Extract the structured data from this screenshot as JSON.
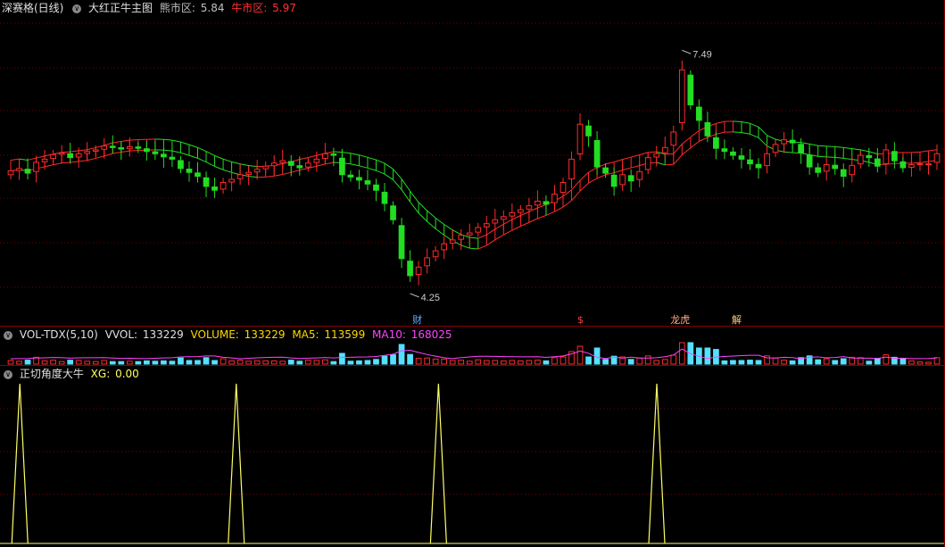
{
  "main": {
    "stock_name": "深赛格(日线)",
    "indicator_name": "大红正牛主图",
    "bear_label": "熊市区:",
    "bear_value": "5.84",
    "bull_label": "牛市区:",
    "bull_value": "5.97",
    "high_label": "7.49",
    "low_label": "4.25",
    "markers": [
      "财",
      "$",
      "龙虎",
      "解"
    ],
    "colors": {
      "up": "#ff2a2a",
      "down": "#22dd22",
      "band_up": "#ff2a2a",
      "band_down": "#22dd22"
    }
  },
  "volume": {
    "name": "VOL-TDX(5,10)",
    "vvol_label": "VVOL:",
    "vvol_value": "133229",
    "volume_label": "VOLUME:",
    "volume_value": "133229",
    "ma5_label": "MA5:",
    "ma5_value": "113599",
    "ma10_label": "MA10:",
    "ma10_value": "168025"
  },
  "indicator": {
    "name": "正切角度大牛",
    "xg_label": "XG:",
    "xg_value": "0.00",
    "peak_positions": [
      0.021,
      0.25,
      0.464,
      0.695
    ]
  },
  "chart_data": {
    "type": "line",
    "title": "",
    "price_range": [
      4.25,
      7.49
    ],
    "closes": [
      5.75,
      5.78,
      5.72,
      5.86,
      5.9,
      5.96,
      5.98,
      5.92,
      5.97,
      6.0,
      6.02,
      6.07,
      6.05,
      6.03,
      6.06,
      6.04,
      6.0,
      5.97,
      5.93,
      5.9,
      5.78,
      5.73,
      5.68,
      5.55,
      5.5,
      5.6,
      5.64,
      5.7,
      5.73,
      5.77,
      5.81,
      5.85,
      5.88,
      5.82,
      5.79,
      5.85,
      5.9,
      5.97,
      5.95,
      5.7,
      5.67,
      5.63,
      5.58,
      5.5,
      5.33,
      5.12,
      4.62,
      4.4,
      4.51,
      4.63,
      4.72,
      4.81,
      4.86,
      4.92,
      4.95,
      5.02,
      5.07,
      5.12,
      5.16,
      5.21,
      5.25,
      5.3,
      5.36,
      5.32,
      5.45,
      5.6,
      5.9,
      6.35,
      6.2,
      5.8,
      5.72,
      5.55,
      5.7,
      5.62,
      5.74,
      5.92,
      5.97,
      6.05,
      6.25,
      7.05,
      6.6,
      6.4,
      6.2,
      6.04,
      6.0,
      5.95,
      5.9,
      5.84,
      5.79,
      5.97,
      6.09,
      6.15,
      6.11,
      5.98,
      5.8,
      5.73,
      5.83,
      5.78,
      5.68,
      5.82,
      5.95,
      5.92,
      5.81,
      6.02,
      5.88,
      5.79,
      5.83,
      5.84,
      5.84,
      5.97
    ]
  }
}
